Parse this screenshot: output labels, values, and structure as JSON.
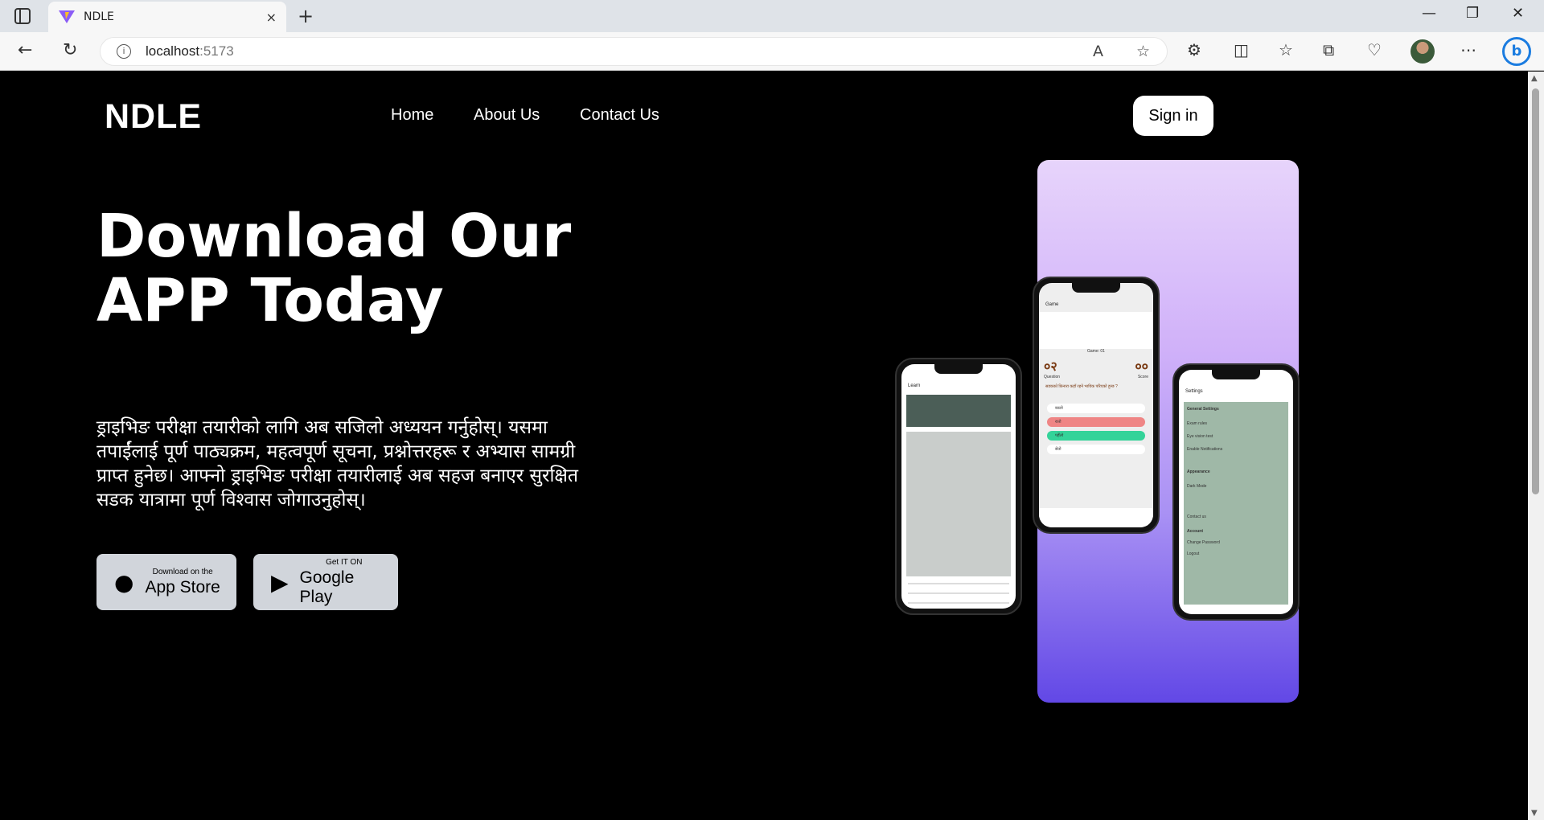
{
  "browser": {
    "tab_title": "NDLE",
    "tab_close": "×",
    "new_tab": "+",
    "url_host": "localhost",
    "url_port": ":5173",
    "window_controls": [
      "—",
      "❐",
      "✕"
    ]
  },
  "nav": {
    "logo": "NDLE",
    "links": [
      "Home",
      "About Us",
      "Contact Us"
    ],
    "signin": "Sign in"
  },
  "hero": {
    "line1": "Download Our",
    "line2": "APP Today",
    "description": "ड्राइभिङ परीक्षा तयारीको लागि अब सजिलो अध्ययन गर्नुहोस्। यसमा तपाईंलाई पूर्ण पाठ्यक्रम, महत्वपूर्ण सूचना, प्रश्नोत्तरहरू र अभ्यास सामग्री प्राप्त हुनेछ। आफ्नो ड्राइभिङ परीक्षा तयारीलाई अब सहज बनाएर सुरक्षित सडक यात्रामा पूर्ण विश्वास जोगाउनुहोस्।"
  },
  "stores": {
    "apple_small": "Download on the",
    "apple_big": "App Store",
    "google_small": "Get IT ON",
    "google_big": "Google Play"
  },
  "phones": {
    "learn_title": "Learn",
    "game_title": "Game",
    "game_score_label": "Game: 01",
    "game_q": "०२",
    "game_s": "००",
    "game_q_label": "Question",
    "game_s_label": "Score",
    "game_question": "सडकको किनारा कहाँ रहने भाविक परिएको हुन्छ ?",
    "game_options": [
      "कालो",
      "रातो",
      "पहेँलो",
      "सेतो"
    ],
    "settings_title": "Settings",
    "settings_sections": [
      "General Settings",
      "Appearance",
      "Account"
    ],
    "settings_items": [
      "Exam rules",
      "Eye vision test",
      "Enable Notifications",
      "Dark Mode",
      "Contact us",
      "Change Password",
      "Logout"
    ]
  },
  "colors": {
    "accent_green": "#34d399",
    "accent_red": "#ef8585",
    "settings_bg": "#9fb8a7"
  }
}
